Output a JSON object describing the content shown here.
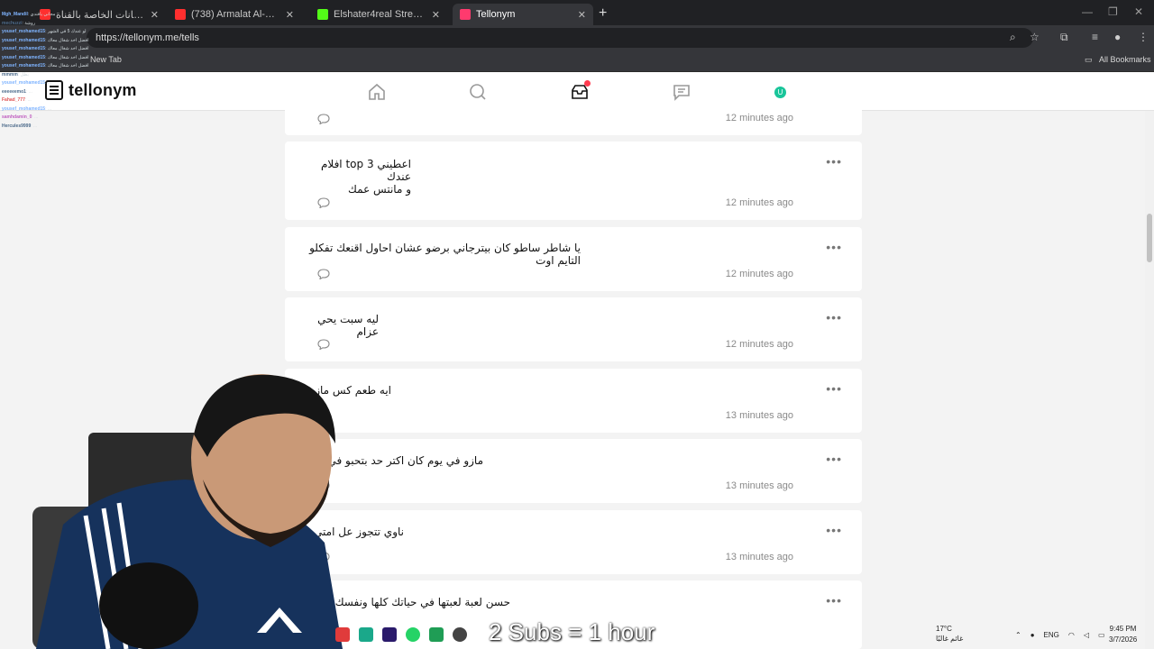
{
  "browser": {
    "tabs": [
      {
        "title": "لوحة البيانات الخاصة بالقناة - YouTube",
        "color": "#ff2f2f",
        "active": false
      },
      {
        "title": "(738) Armalat Al-Alpha - YouTube",
        "color": "#ff2f2f",
        "active": false
      },
      {
        "title": "Elshater4real Stream - Watch Live",
        "color": "#53fc18",
        "active": false
      },
      {
        "title": "Tellonym",
        "color": "#ff3a6e",
        "active": true
      }
    ],
    "new_tab_symbol": "+",
    "url": "https://tellonym.me/tells",
    "bookmarks_bar": {
      "new_tab_label": "New Tab",
      "all_bookmarks_label": "All Bookmarks"
    }
  },
  "site": {
    "logo_text": "tellonym",
    "accent_color": "#19c59a",
    "notification_color": "#ff3b4f",
    "profile_initial": "U",
    "nav": [
      "home-icon",
      "search-icon",
      "inbox-icon",
      "chat-icon",
      "profile-avatar"
    ]
  },
  "feed": {
    "tells": [
      {
        "text": "",
        "time": "12 minutes ago"
      },
      {
        "text": "اعطيني top 3 افلام عندك\nو مانتس عمك",
        "time": "12 minutes ago"
      },
      {
        "text": "يا شاطر ساطو كان بيترجاني برضو عشان احاول اقنعك تفكلو التايم اوت",
        "time": "12 minutes ago"
      },
      {
        "text": "ليه سبت يحي عزام",
        "time": "12 minutes ago"
      },
      {
        "text": "ايه طعم كس مازو",
        "time": "13 minutes ago"
      },
      {
        "text": "مازو في يوم كان اكتر حد بتحبو في ال",
        "time": "13 minutes ago"
      },
      {
        "text": "ناوي تتجوز عل امتي",
        "time": "13 minutes ago"
      },
      {
        "text": "حسن لعبة لعبتها في حياتك كلها ونفسك تلـ",
        "time": ""
      }
    ]
  },
  "stream_overlay": {
    "chat": [
      {
        "user": "Mgh_Mandil",
        "msg": "مجاني يافندي"
      },
      {
        "user": "mechuzzi",
        "msg": "روشة"
      },
      {
        "user": "yousef_mohamed15",
        "msg": "لو عندك 5 في الشهر"
      },
      {
        "user": "yousef_mohamed15",
        "msg": "افضل اخد شغال معاك"
      },
      {
        "user": "yousef_mohamed15",
        "msg": "افضل اخد شغال معاك"
      },
      {
        "user": "yousef_mohamed15",
        "msg": "افضل اخد شغال معاك"
      },
      {
        "user": "yousef_mohamed15",
        "msg": "افضل اخد شغال معاك"
      },
      {
        "user": "mmmm",
        "msg": "بطل"
      },
      {
        "user": "yousef_mohamed15",
        "msg": "..."
      },
      {
        "user": "eeeeeemo1",
        "msg": "..."
      },
      {
        "user": "Fahad_777",
        "msg": "..."
      },
      {
        "user": "yousef_mohamed15",
        "msg": "..."
      },
      {
        "user": "samhdamin_0",
        "msg": "..."
      },
      {
        "user": "Hercules9999",
        "msg": "..."
      }
    ],
    "subs_goal": "2 Subs = 1 hour"
  },
  "taskbar": {
    "weather_temp": "17°C",
    "weather_desc": "غائم غالبًا",
    "language": "ENG",
    "time": "9:45 PM",
    "date": "3/7/2026"
  }
}
